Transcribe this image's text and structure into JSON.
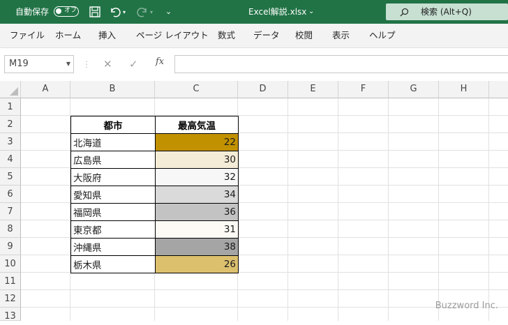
{
  "titlebar": {
    "autosave_label": "自動保存",
    "autosave_state": "オフ",
    "filename": "Excel解説.xlsx",
    "search_placeholder": "検索 (Alt+Q)",
    "color": "#217346"
  },
  "menu": [
    "ファイル",
    "ホーム",
    "挿入",
    "ページ レイアウト",
    "数式",
    "データ",
    "校閲",
    "表示",
    "ヘルプ"
  ],
  "formulabar": {
    "namebox": "M19",
    "fx": "fx",
    "value": ""
  },
  "columns": [
    "A",
    "B",
    "C",
    "D",
    "E",
    "F",
    "G",
    "H"
  ],
  "rows": [
    "1",
    "2",
    "3",
    "4",
    "5",
    "6",
    "7",
    "8",
    "9",
    "10",
    "11",
    "12",
    "13"
  ],
  "table": {
    "header": {
      "city": "都市",
      "temp": "最高気温"
    },
    "rows": [
      {
        "city": "北海道",
        "temp": "22",
        "bg": "#c19100"
      },
      {
        "city": "広島県",
        "temp": "30",
        "bg": "#f4ecd6"
      },
      {
        "city": "大阪府",
        "temp": "32",
        "bg": "#f7f7f7"
      },
      {
        "city": "愛知県",
        "temp": "34",
        "bg": "#dadada"
      },
      {
        "city": "福岡県",
        "temp": "36",
        "bg": "#c3c3c3"
      },
      {
        "city": "東京都",
        "temp": "31",
        "bg": "#fdfaf5"
      },
      {
        "city": "沖縄県",
        "temp": "38",
        "bg": "#a5a5a5"
      },
      {
        "city": "栃木県",
        "temp": "26",
        "bg": "#dcc06e"
      }
    ]
  },
  "watermark": "Buzzword Inc."
}
